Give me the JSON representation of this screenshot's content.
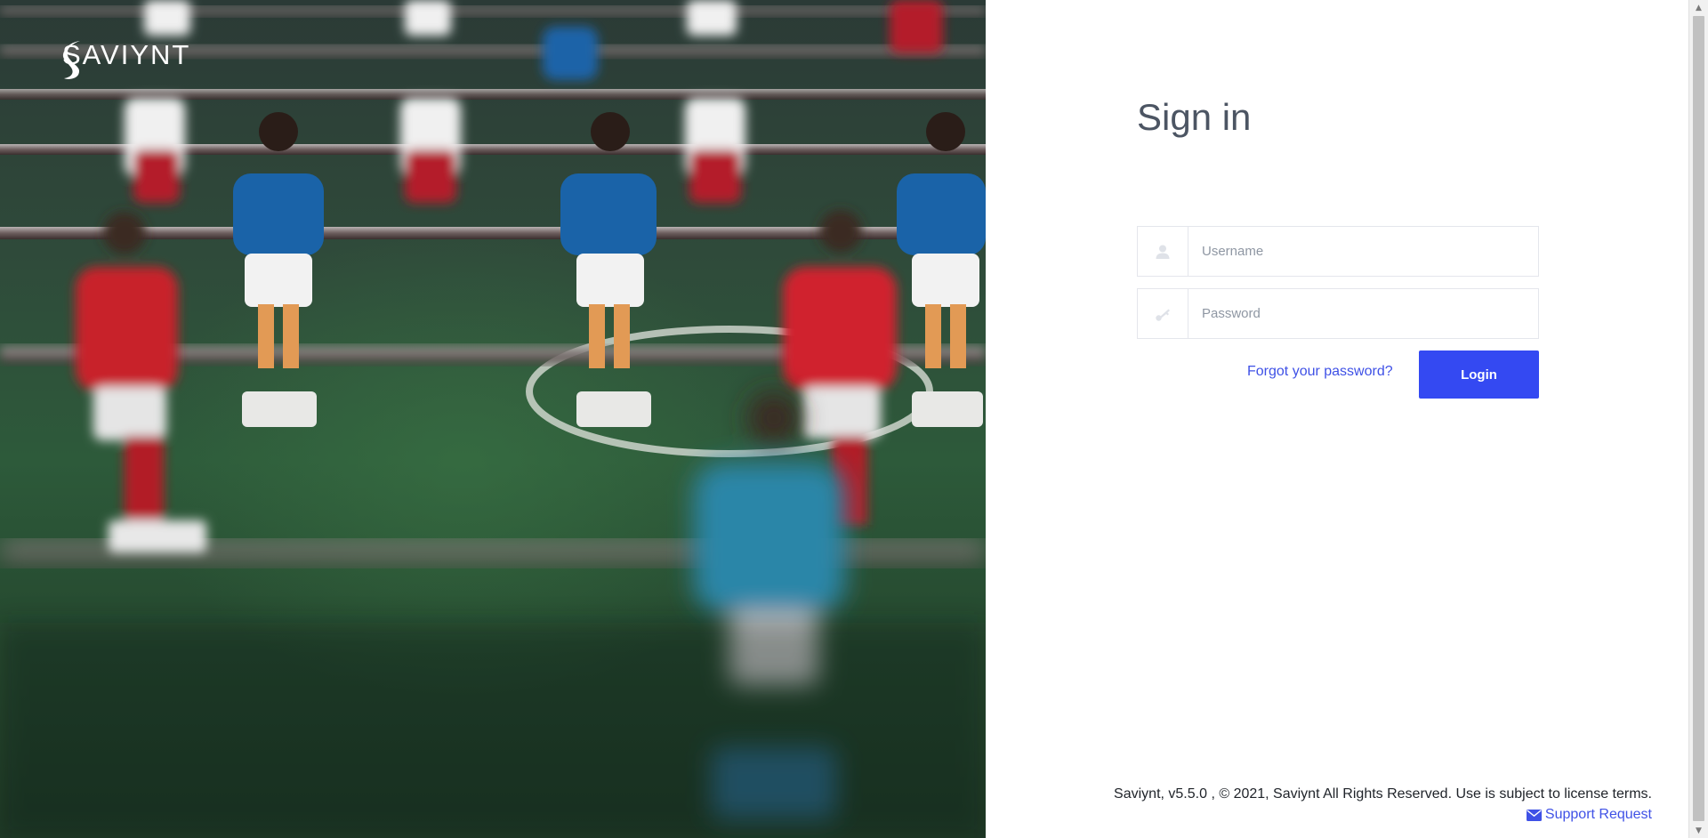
{
  "brand": {
    "logo_text": "SAVIYNT"
  },
  "signin": {
    "title": "Sign in",
    "username_placeholder": "Username",
    "password_placeholder": "Password",
    "forgot_label": "Forgot your password?",
    "login_label": "Login"
  },
  "footer": {
    "copyright": "Saviynt, v5.5.0 , © 2021, Saviynt All Rights Reserved. Use is subject to license terms.",
    "support_label": "Support Request"
  },
  "icons": {
    "username": "user-icon",
    "password": "key-icon",
    "support": "envelope-icon"
  },
  "colors": {
    "accent": "#3449f2",
    "link": "#3f51e6",
    "title": "#4c5563"
  }
}
